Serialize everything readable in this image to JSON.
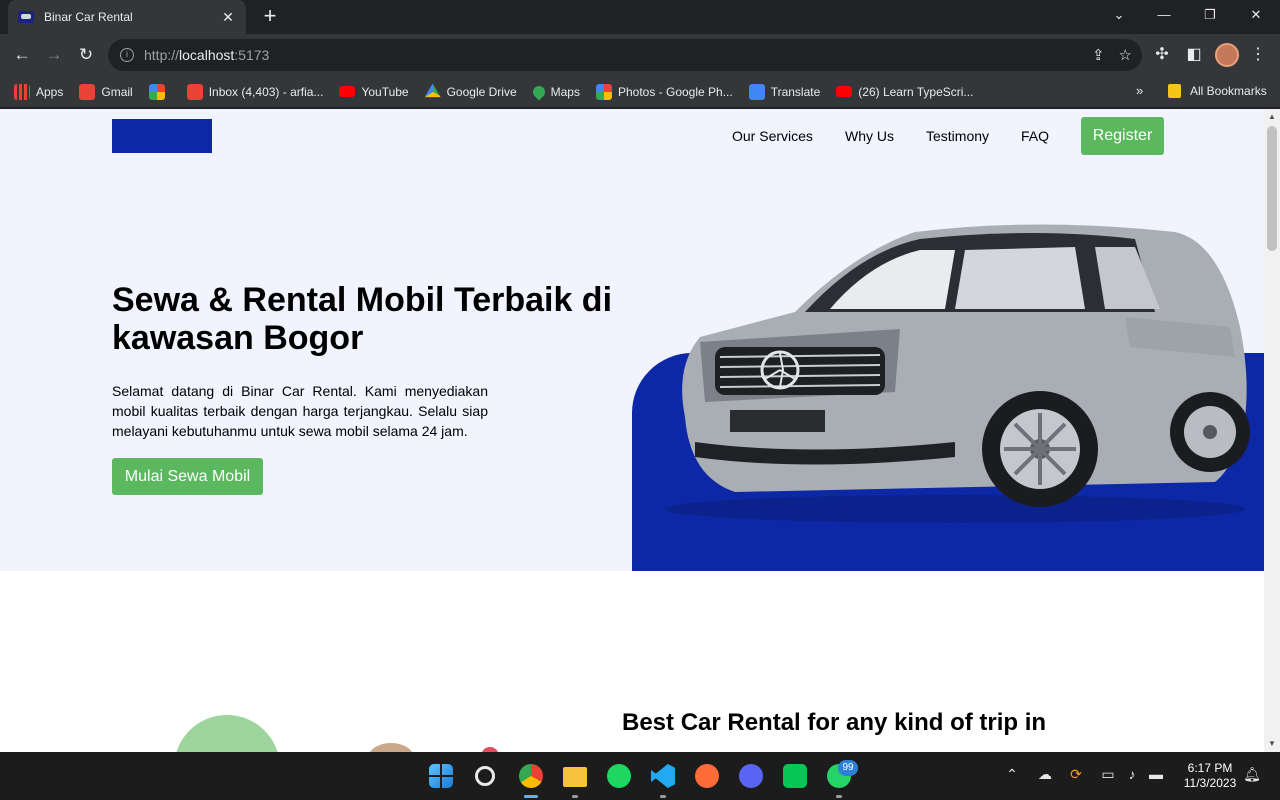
{
  "browser": {
    "tab_title": "Binar Car Rental",
    "tab_close": "✕",
    "new_tab": "+",
    "url_scheme": "http://",
    "url_host": "localhost",
    "url_port": ":5173",
    "bookmarks": [
      {
        "label": "Apps",
        "icon": "apps-grid-icon",
        "color": "#ea4335"
      },
      {
        "label": "Gmail",
        "icon": "gmail-icon",
        "color": "#ea4335"
      },
      {
        "label": "",
        "icon": "pinwheel-icon",
        "color": "#fbbc04"
      },
      {
        "label": "Inbox (4,403) - arfia...",
        "icon": "gmail-icon",
        "color": "#ea4335"
      },
      {
        "label": "YouTube",
        "icon": "youtube-icon",
        "color": "#ff0000"
      },
      {
        "label": "Google Drive",
        "icon": "drive-icon",
        "color": "#34a853"
      },
      {
        "label": "Maps",
        "icon": "maps-icon",
        "color": "#34a853"
      },
      {
        "label": "Photos - Google Ph...",
        "icon": "photos-icon",
        "color": "#fbbc04"
      },
      {
        "label": "Translate",
        "icon": "translate-icon",
        "color": "#4285f4"
      },
      {
        "label": "(26) Learn TypeScri...",
        "icon": "youtube-icon",
        "color": "#ff0000"
      }
    ],
    "bookmarks_more": "»",
    "all_bookmarks": "All Bookmarks"
  },
  "page": {
    "nav": [
      "Our Services",
      "Why Us",
      "Testimony",
      "FAQ"
    ],
    "register_label": "Register",
    "hero_title": "Sewa & Rental Mobil Terbaik di kawasan Bogor",
    "hero_desc": "Selamat datang di Binar Car Rental. Kami menyediakan mobil kualitas terbaik dengan harga terjangkau. Selalu siap melayani kebutuhanmu untuk sewa mobil selama 24 jam.",
    "cta_label": "Mulai Sewa Mobil",
    "section2_title": "Best Car Rental for any kind of trip in",
    "brand_color": "#0d28a6",
    "accent_color": "#5cb85f"
  },
  "taskbar": {
    "whatsapp_badge": "99",
    "time": "6:17 PM",
    "date": "11/3/2023"
  }
}
